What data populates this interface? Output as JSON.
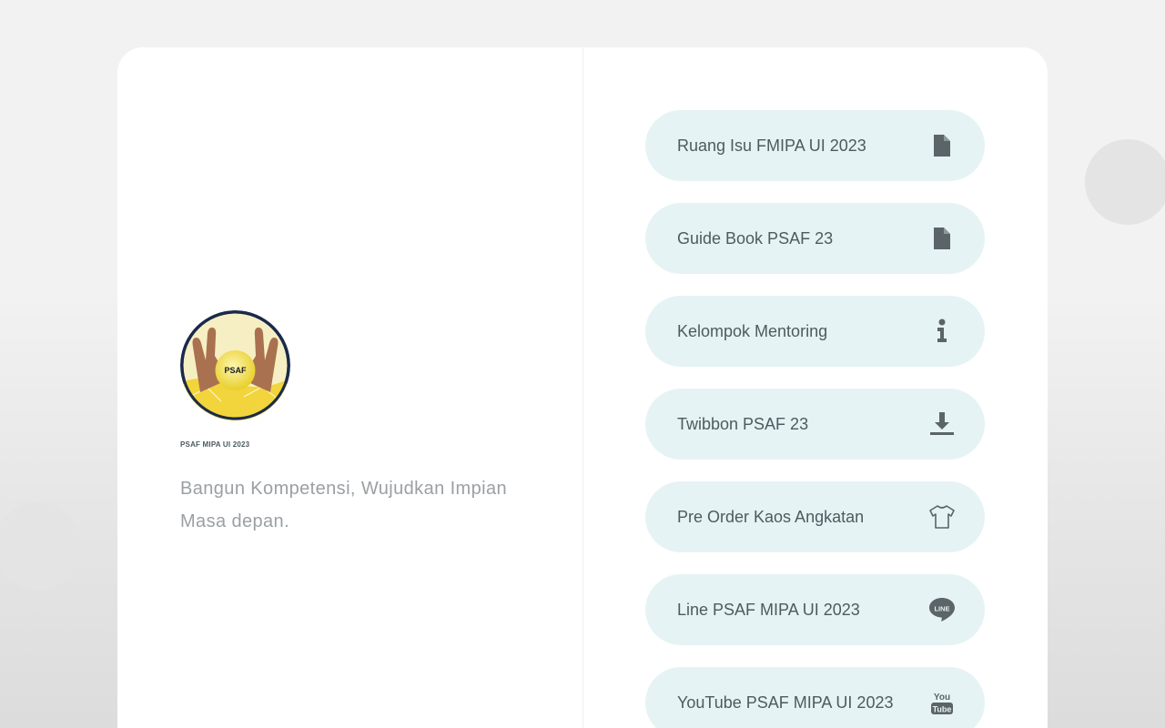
{
  "profile": {
    "name": "PSAF MIPA UI 2023",
    "tagline": "Bangun Kompetensi, Wujudkan Impian Masa depan.",
    "avatar_text": "PSAF"
  },
  "links": [
    {
      "label": "Ruang Isu FMIPA UI 2023",
      "icon": "document-icon"
    },
    {
      "label": "Guide Book PSAF 23",
      "icon": "document-icon"
    },
    {
      "label": "Kelompok Mentoring",
      "icon": "info-icon"
    },
    {
      "label": "Twibbon PSAF 23",
      "icon": "download-icon"
    },
    {
      "label": "Pre Order Kaos Angkatan",
      "icon": "tshirt-icon"
    },
    {
      "label": "Line PSAF MIPA UI 2023",
      "icon": "line-icon"
    },
    {
      "label": "YouTube PSAF MIPA UI 2023",
      "icon": "youtube-icon"
    }
  ],
  "colors": {
    "button_bg": "#e6f3f5",
    "button_text": "#4f5a5e",
    "icon": "#5b6468",
    "tagline": "#9aa0a3"
  }
}
